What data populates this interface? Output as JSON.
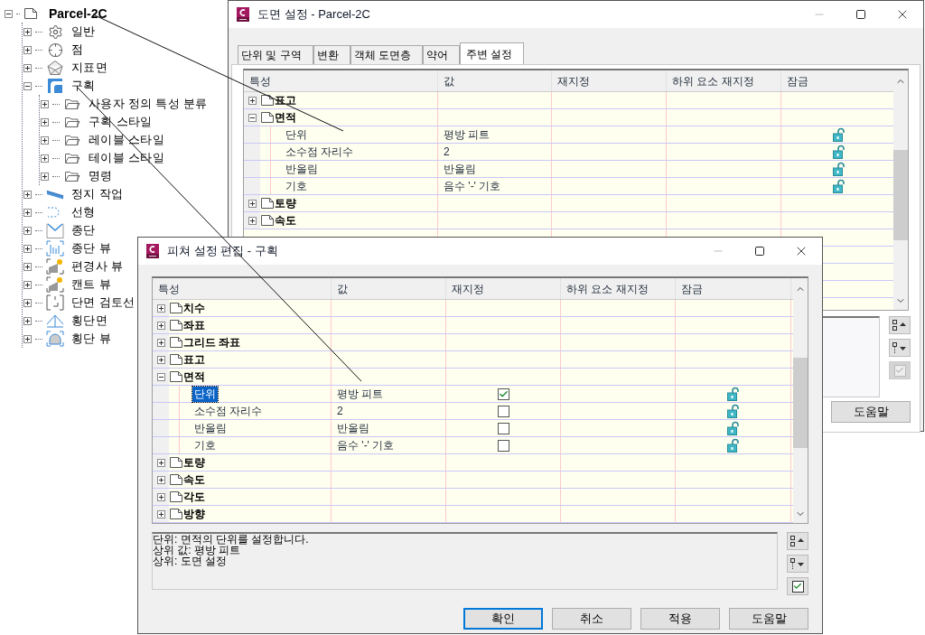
{
  "tree": {
    "label": "Parcel-2C",
    "expanded": true,
    "children": [
      {
        "label": "일반",
        "expanded": false
      },
      {
        "label": "점",
        "expanded": false
      },
      {
        "label": "지표면",
        "expanded": false
      },
      {
        "label": "구획",
        "expanded": true,
        "children": [
          {
            "label": "사용자 정의 특성 분류",
            "expanded": false
          },
          {
            "label": "구획 스타일",
            "expanded": false
          },
          {
            "label": "레이블 스타일",
            "expanded": false
          },
          {
            "label": "테이블 스타일",
            "expanded": false
          },
          {
            "label": "명령",
            "expanded": false
          }
        ]
      },
      {
        "label": "정지 작업",
        "expanded": false
      },
      {
        "label": "선형",
        "expanded": false
      },
      {
        "label": "종단",
        "expanded": false
      },
      {
        "label": "종단 뷰",
        "expanded": false
      },
      {
        "label": "편경사 뷰",
        "expanded": false
      },
      {
        "label": "캔트 뷰",
        "expanded": false
      },
      {
        "label": "단면 검토선",
        "expanded": false
      },
      {
        "label": "횡단면",
        "expanded": false
      },
      {
        "label": "횡단 뷰",
        "expanded": false
      }
    ]
  },
  "drawing_settings_window": {
    "title": "도면 설정 - Parcel-2C",
    "tabs": [
      {
        "label": "단위 및 구역",
        "selected": false
      },
      {
        "label": "변환",
        "selected": false
      },
      {
        "label": "객체 도면층",
        "selected": false
      },
      {
        "label": "약어",
        "selected": false
      },
      {
        "label": "주변 설정",
        "selected": true
      }
    ],
    "columns": [
      "특성",
      "값",
      "재지정",
      "하위 요소 재지정",
      "잠금"
    ],
    "rows": [
      {
        "kind": "group",
        "label": "표고",
        "expanded": false
      },
      {
        "kind": "group",
        "label": "면적",
        "expanded": true
      },
      {
        "kind": "property",
        "label": "단위",
        "value": "평방 피트",
        "selected": false,
        "locked": false
      },
      {
        "kind": "property",
        "label": "소수점 자리수",
        "value": "2",
        "selected": false,
        "locked": false
      },
      {
        "kind": "property",
        "label": "반올림",
        "value": "반올림",
        "selected": false,
        "locked": false
      },
      {
        "kind": "property",
        "label": "기호",
        "value": "음수 '-' 기호",
        "selected": false,
        "locked": false
      },
      {
        "kind": "group",
        "label": "토량",
        "expanded": false
      },
      {
        "kind": "group",
        "label": "속도",
        "expanded": false
      }
    ],
    "buttons": [
      "도움말"
    ]
  },
  "feature_window": {
    "title": "피쳐 설정 편집 - 구획",
    "columns": [
      "특성",
      "값",
      "재지정",
      "하위 요소 재지정",
      "잠금"
    ],
    "rows": [
      {
        "kind": "group",
        "label": "치수",
        "expanded": false
      },
      {
        "kind": "group",
        "label": "좌표",
        "expanded": false
      },
      {
        "kind": "group",
        "label": "그리드 좌표",
        "expanded": false
      },
      {
        "kind": "group",
        "label": "표고",
        "expanded": false
      },
      {
        "kind": "group",
        "label": "면적",
        "expanded": true
      },
      {
        "kind": "property",
        "label": "단위",
        "value": "평방 피트",
        "selected": true,
        "override": true,
        "locked": false
      },
      {
        "kind": "property",
        "label": "소수점 자리수",
        "value": "2",
        "selected": false,
        "override": false,
        "locked": false
      },
      {
        "kind": "property",
        "label": "반올림",
        "value": "반올림",
        "selected": false,
        "override": false,
        "locked": false
      },
      {
        "kind": "property",
        "label": "기호",
        "value": "음수 '-' 기호",
        "selected": false,
        "override": false,
        "locked": false
      },
      {
        "kind": "group",
        "label": "토량",
        "expanded": false
      },
      {
        "kind": "group",
        "label": "속도",
        "expanded": false
      },
      {
        "kind": "group",
        "label": "각도",
        "expanded": false
      },
      {
        "kind": "group",
        "label": "방향",
        "expanded": false
      }
    ],
    "description": [
      "단위: 면적의 단위를 설정합니다.",
      "상위 값: 평방 피트",
      "상위: 도면 설정"
    ],
    "buttons": [
      {
        "label": "확인",
        "default": true
      },
      {
        "label": "취소",
        "default": false
      },
      {
        "label": "적용",
        "default": false
      },
      {
        "label": "도움말",
        "default": false
      }
    ]
  }
}
